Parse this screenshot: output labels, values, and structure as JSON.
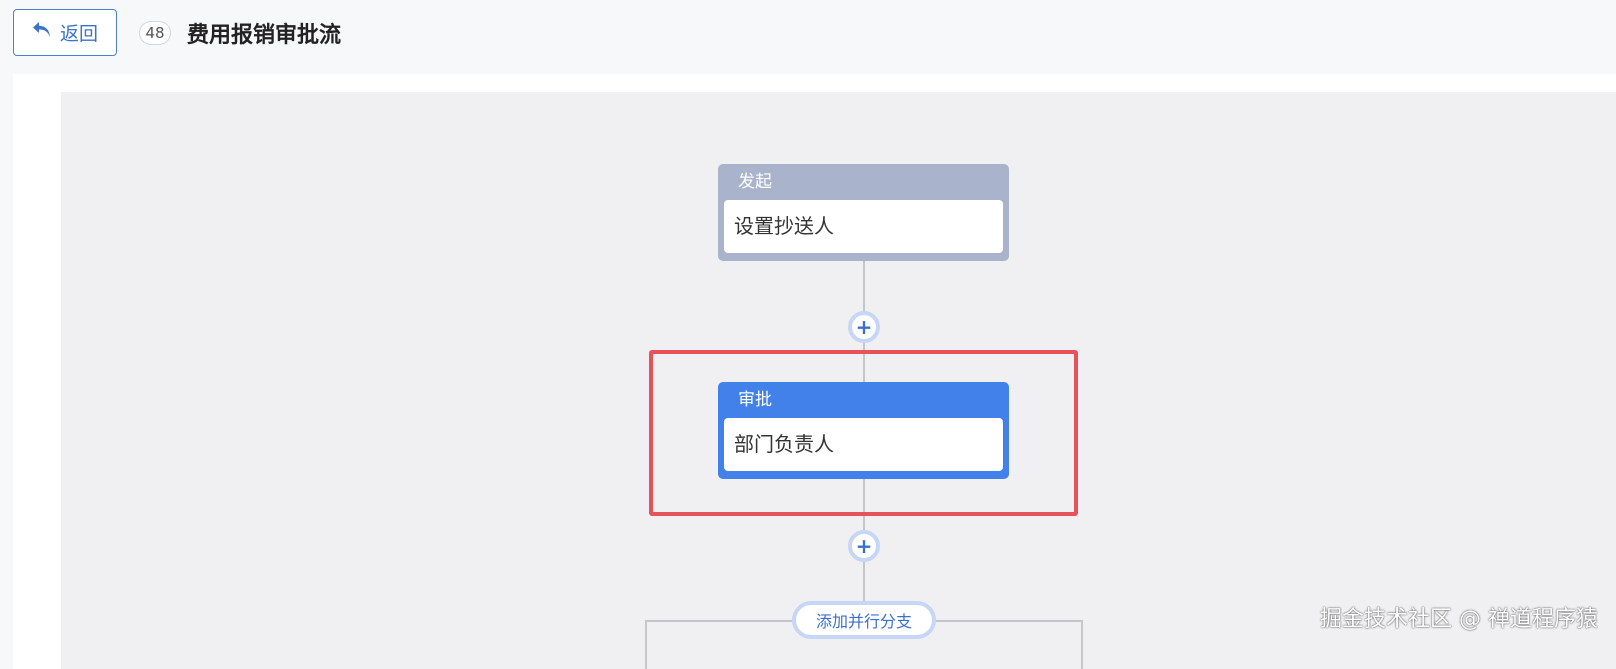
{
  "header": {
    "back_label": "返回",
    "count": "48",
    "title": "费用报销审批流"
  },
  "flow": {
    "start_node": {
      "type_label": "发起",
      "content": "设置抄送人"
    },
    "approve_node": {
      "type_label": "审批",
      "content": "部门负责人"
    },
    "add_symbol": "+",
    "branch_label": "添加并行分支"
  },
  "watermark": "掘金技术社区 @ 禅道程序猿",
  "colors": {
    "accent": "#4381ea",
    "start_node": "#a9b4cc",
    "highlight": "#e5525a"
  },
  "icons": {
    "back": "back-arrow-icon"
  }
}
